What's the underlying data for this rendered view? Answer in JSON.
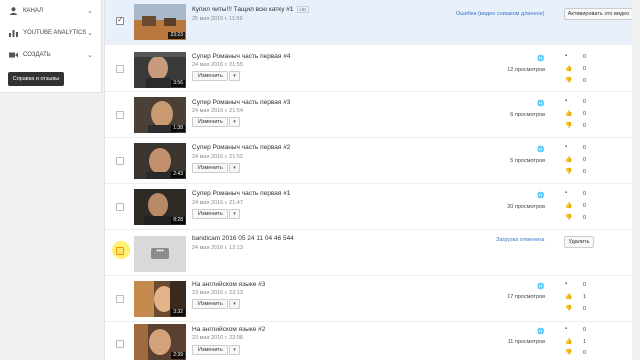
{
  "sidebar": {
    "items": [
      {
        "label": "Канал",
        "icon": "person-icon"
      },
      {
        "label": "YouTube Analytics",
        "icon": "bar-chart-icon"
      },
      {
        "label": "Создать",
        "icon": "video-camera-icon"
      }
    ],
    "help_button": "Справка и отзывы"
  },
  "videos": [
    {
      "title": "Купил читы!!! Тащил всю катку #1",
      "badge": "HD",
      "date": "25 мая 2016 г. 11:59",
      "duration": "23:23",
      "status": "Ошибка (видео слишком длинное)",
      "action": "Активировать это видео",
      "checked": true
    },
    {
      "title": "Супер Романыч часть первая #4",
      "date": "24 мая 2016 г. 21:55",
      "duration": "3:56",
      "edit": "Изменить",
      "views": "12 просмотров",
      "comments": "0",
      "likes": "0",
      "dislikes": "0"
    },
    {
      "title": "Супер Романыч часть первая #3",
      "date": "24 мая 2016 г. 21:54",
      "duration": "1:38",
      "edit": "Изменить",
      "views": "6 просмотров",
      "comments": "0",
      "likes": "0",
      "dislikes": "0"
    },
    {
      "title": "Супер Романыч часть первая #2",
      "date": "24 мая 2016 г. 21:52",
      "duration": "2:43",
      "edit": "Изменить",
      "views": "5 просмотров",
      "comments": "0",
      "likes": "0",
      "dislikes": "0"
    },
    {
      "title": "Супер Романыч часть первая #1",
      "date": "24 мая 2016 г. 21:47",
      "duration": "8:28",
      "edit": "Изменить",
      "views": "20 просмотров",
      "comments": "0",
      "likes": "0",
      "dislikes": "0"
    },
    {
      "title": "bandicam 2016 05 24 11 04 46 544",
      "date": "24 мая 2016 г. 12:13",
      "status": "Загрузка отменена",
      "action": "Удалить"
    },
    {
      "title": "На английском языке #3",
      "date": "23 мая 2016 г. 22:13",
      "duration": "3:32",
      "edit": "Изменить",
      "views": "17 просмотров",
      "comments": "0",
      "likes": "1",
      "dislikes": "0"
    },
    {
      "title": "На английском языке #2",
      "date": "23 мая 2016 г. 22:08",
      "duration": "2:39",
      "edit": "Изменить",
      "views": "11 просмотров",
      "comments": "0",
      "likes": "1",
      "dislikes": "0"
    }
  ],
  "colors": {
    "accent": "#3d74c5",
    "selected_row": "#e8f0fb"
  }
}
